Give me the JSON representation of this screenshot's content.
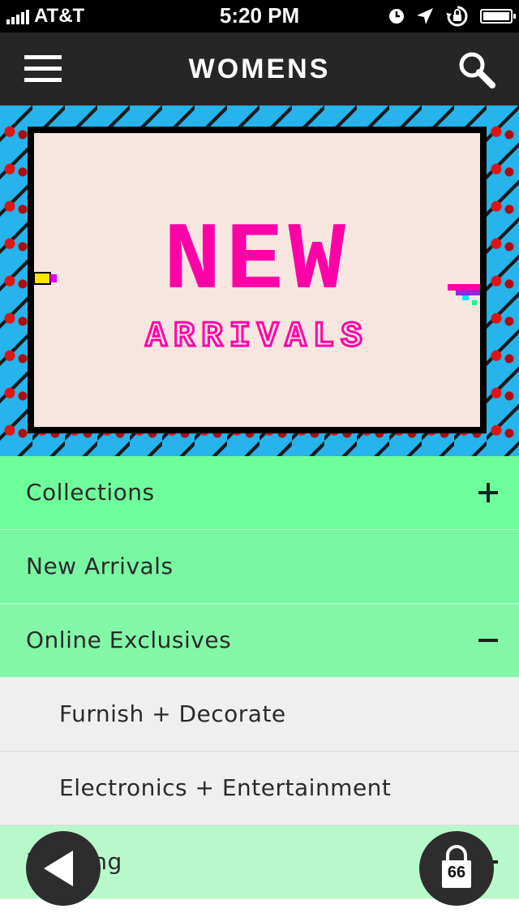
{
  "status_bar": {
    "carrier": "AT&T",
    "time": "5:20 PM"
  },
  "nav": {
    "title": "WOMENS",
    "menu_icon": "hamburger-menu-icon",
    "search_icon": "search-icon"
  },
  "banner": {
    "headline": "NEW",
    "subheadline": "ARRIVALS",
    "colors": {
      "pattern_background": "#27b3ec",
      "frame": "#000000",
      "panel": "#f6e6df",
      "text": "#ff00a8"
    }
  },
  "menu": {
    "items": [
      {
        "label": "Collections",
        "toggle": "+",
        "color": "#6ffd9b"
      },
      {
        "label": "New Arrivals",
        "toggle": "",
        "color": "#78f7a3"
      },
      {
        "label": "Online Exclusives",
        "toggle": "−",
        "color": "#84f6a8"
      },
      {
        "label": "Furnish + Decorate",
        "toggle": "",
        "color": "#efefef"
      },
      {
        "label": "Electronics + Entertainment",
        "toggle": "",
        "color": "#efefef"
      },
      {
        "label": "Bedding",
        "toggle": "+",
        "color": "#b7f9cb"
      }
    ]
  },
  "floating": {
    "back_icon": "back-arrow-icon",
    "bag_icon": "shopping-bag-icon",
    "bag_count": "66"
  }
}
